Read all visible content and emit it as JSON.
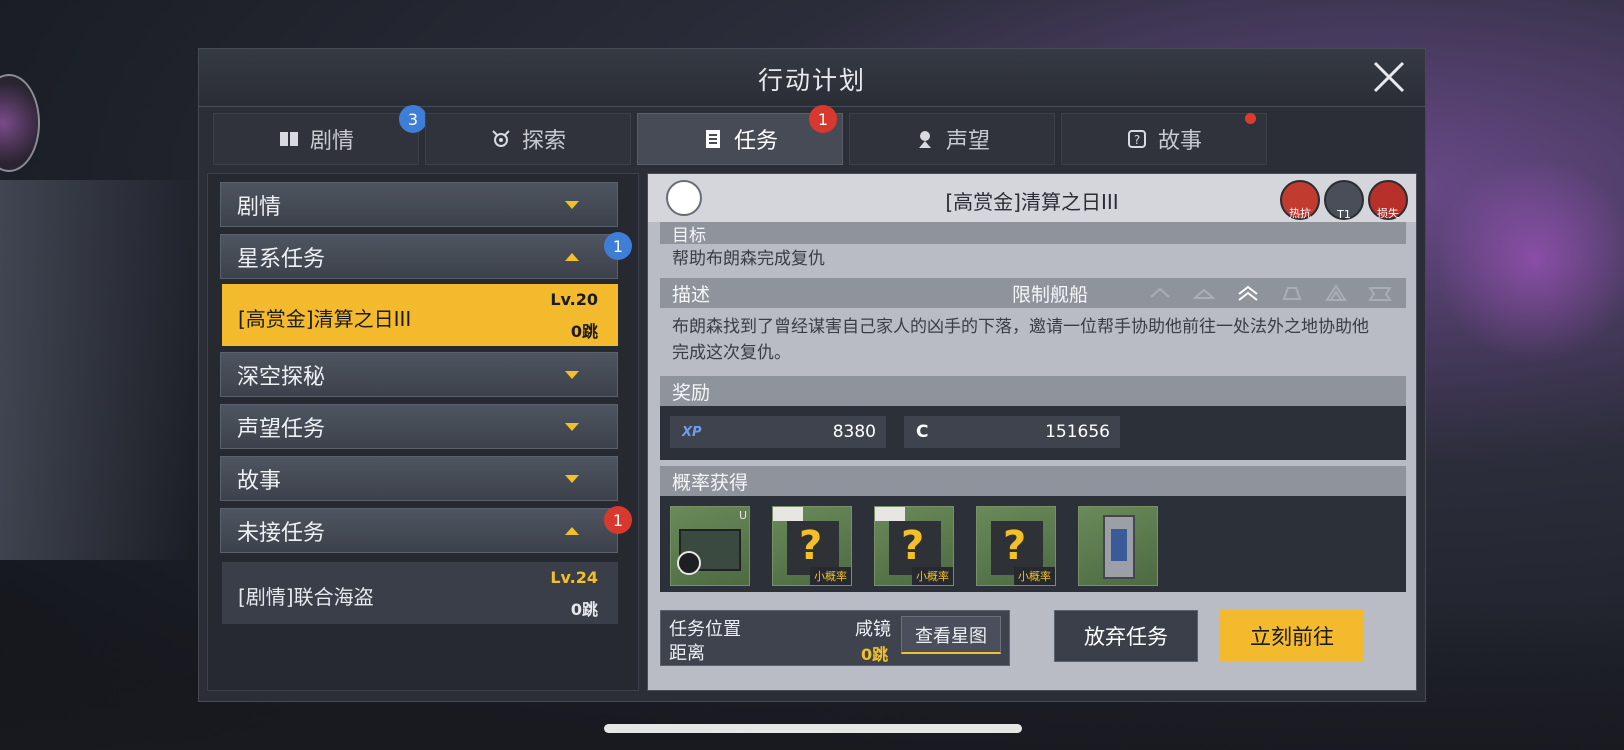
{
  "title": "行动计划",
  "tabs": [
    {
      "label": "剧情",
      "badge": "3",
      "icon": "book-icon"
    },
    {
      "label": "探索",
      "icon": "explore-icon"
    },
    {
      "label": "任务",
      "badge": "1",
      "icon": "document-icon"
    },
    {
      "label": "声望",
      "icon": "reputation-icon"
    },
    {
      "label": "故事",
      "icon": "story-icon"
    }
  ],
  "categories": {
    "juqing": "剧情",
    "xingxi": "星系任务",
    "xingxi_badge": "1",
    "shenkong": "深空探秘",
    "shengwang": "声望任务",
    "gushi": "故事",
    "weijie": "未接任务",
    "weijie_badge": "1"
  },
  "missions": [
    {
      "name": "[高赏金]清算之日III",
      "level": "Lv.20",
      "jumps": "0跳"
    },
    {
      "name": "[剧情]联合海盗",
      "level": "Lv.24",
      "jumps": "0跳"
    }
  ],
  "detail": {
    "title": "[高赏金]清算之日III",
    "header_icons": [
      "热抗",
      "T1",
      "损失"
    ],
    "goal_label": "目标",
    "goal_text": "帮助布朗森完成复仇",
    "desc_label": "描述",
    "ship_limit_label": "限制舰船",
    "desc_text": "布朗森找到了曾经谋害自己家人的凶手的下落，邀请一位帮手协助他前往一处法外之地协助他完成这次复仇。",
    "reward_label": "奖励",
    "rewards": [
      {
        "label": "XP",
        "value": "8380"
      },
      {
        "label": "C",
        "value": "151656"
      }
    ],
    "drop_label": "概率获得",
    "drops": [
      {
        "tag": "U",
        "name": "supply-crate"
      },
      {
        "tag": "小概率",
        "name": "mystery-box"
      },
      {
        "tag": "小概率",
        "name": "mystery-box"
      },
      {
        "tag": "小概率",
        "name": "mystery-box"
      },
      {
        "tag": "",
        "name": "device-item"
      }
    ],
    "location_label": "任务位置",
    "location_value": "咸镜",
    "distance_label": "距离",
    "distance_value": "0跳",
    "map_button": "查看星图",
    "abandon_button": "放弃任务",
    "go_button": "立刻前往"
  },
  "colors": {
    "accent": "#f3ba2e",
    "badge_blue": "#3f7ed6",
    "badge_red": "#d8392f"
  }
}
